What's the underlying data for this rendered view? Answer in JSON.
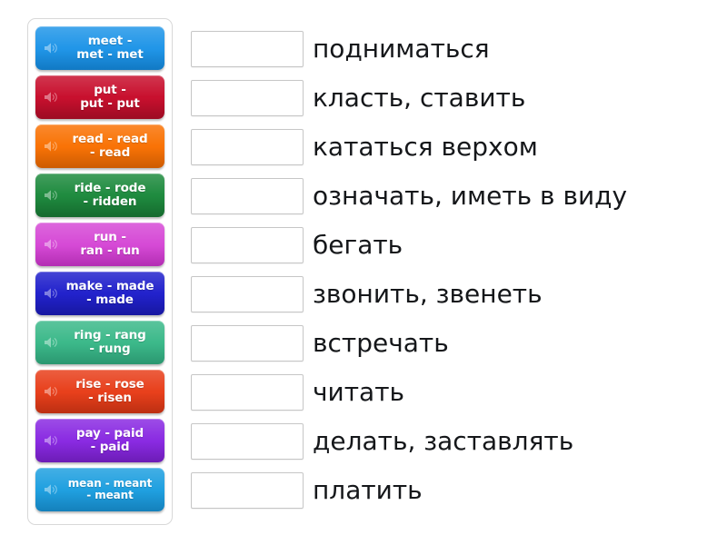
{
  "activity": {
    "type": "match-up",
    "language_pair": "English irregular verbs — Russian meanings"
  },
  "tiles": {
    "speaker_icon_name": "speaker-icon",
    "items": [
      {
        "id": "meet",
        "label": "meet -\nmet - met",
        "color": "#2196e8",
        "color_dark": "#1179c4",
        "size": "normal"
      },
      {
        "id": "put",
        "label": "put -\nput - put",
        "color": "#c8102e",
        "color_dark": "#9c0b23",
        "size": "normal"
      },
      {
        "id": "read",
        "label": "read - read\n- read",
        "color": "#f97306",
        "color_dark": "#cc5c02",
        "size": "normal"
      },
      {
        "id": "ride",
        "label": "ride - rode\n- ridden",
        "color": "#1f8b3f",
        "color_dark": "#156a2e",
        "size": "normal"
      },
      {
        "id": "run",
        "label": "run -\nran - run",
        "color": "#d64ad6",
        "color_dark": "#b32eb3",
        "size": "normal"
      },
      {
        "id": "make",
        "label": "make - made\n- made",
        "color": "#2222cc",
        "color_dark": "#1717a0",
        "size": "normal"
      },
      {
        "id": "ring",
        "label": "ring - rang\n- rung",
        "color": "#3cb98a",
        "color_dark": "#2b9770",
        "size": "normal"
      },
      {
        "id": "rise",
        "label": "rise - rose\n- risen",
        "color": "#e8401c",
        "color_dark": "#bc2f12",
        "size": "normal"
      },
      {
        "id": "pay",
        "label": "pay - paid\n- paid",
        "color": "#8a2be2",
        "color_dark": "#6c1cb6",
        "size": "normal"
      },
      {
        "id": "mean",
        "label": "mean - meant\n- meant",
        "color": "#20a0e0",
        "color_dark": "#1480bb",
        "size": "small"
      }
    ]
  },
  "rows": [
    {
      "drop_placeholder": "",
      "answer": "подниматься"
    },
    {
      "drop_placeholder": "",
      "answer": "класть, ставить"
    },
    {
      "drop_placeholder": "",
      "answer": "кататься верхом"
    },
    {
      "drop_placeholder": "",
      "answer": "означать, иметь в виду"
    },
    {
      "drop_placeholder": "",
      "answer": "бегать"
    },
    {
      "drop_placeholder": "",
      "answer": "звонить, звенеть"
    },
    {
      "drop_placeholder": "",
      "answer": "встречать"
    },
    {
      "drop_placeholder": "",
      "answer": "читать"
    },
    {
      "drop_placeholder": "",
      "answer": "делать, заставлять"
    },
    {
      "drop_placeholder": "",
      "answer": "платить"
    }
  ],
  "colors": {
    "page_background": "#ffffff",
    "panel_border": "#d8d8d8",
    "drop_box_border": "#c6c6c6",
    "answer_text": "#15171a"
  }
}
